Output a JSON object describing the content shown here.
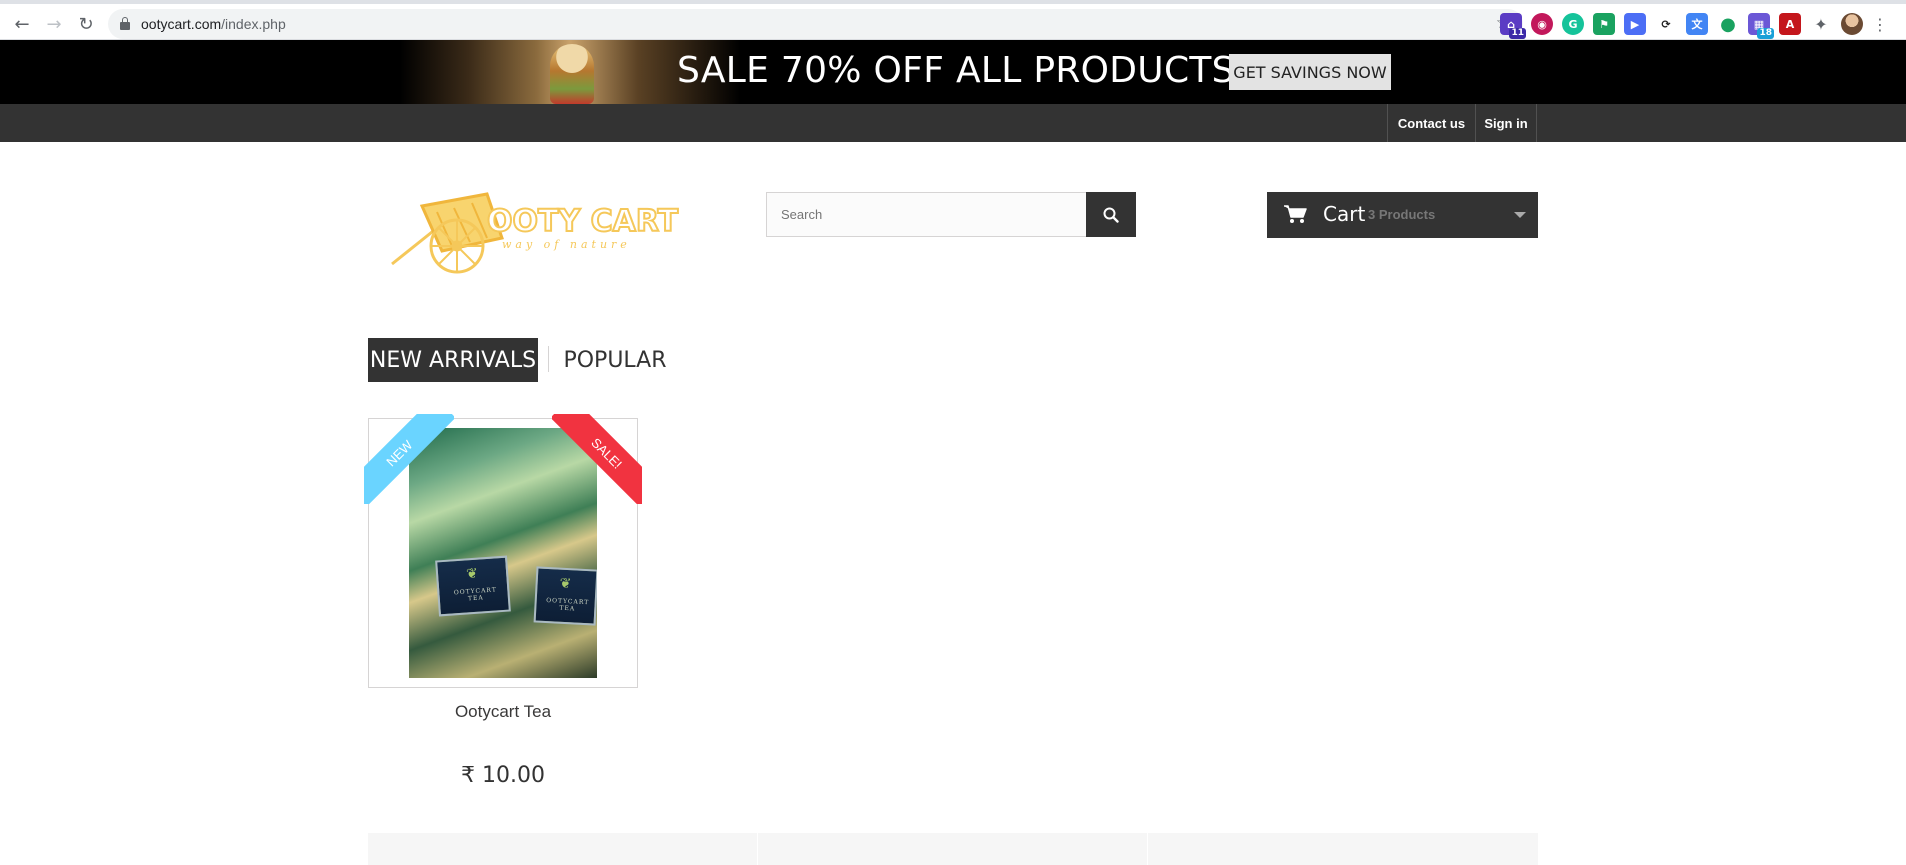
{
  "browser": {
    "url_host": "ootycart.com",
    "url_path": "/index.php",
    "extension_badges": [
      "11",
      "18"
    ]
  },
  "promo": {
    "headline": "SALE 70% OFF ALL PRODUCTS",
    "button_label": "GET SAVINGS NOW"
  },
  "topnav": {
    "contact_label": "Contact us",
    "signin_label": "Sign in"
  },
  "logo": {
    "title": "OOTY CART",
    "tagline": "way of nature",
    "color": "#f5c85a"
  },
  "search": {
    "placeholder": "Search"
  },
  "cart": {
    "label": "Cart",
    "count": "3 Products"
  },
  "tabs": [
    {
      "label": "NEW ARRIVALS",
      "active": true
    },
    {
      "label": "POPULAR",
      "active": false
    }
  ],
  "product": {
    "name": "Ootycart Tea",
    "price": "₹ 10.00",
    "badge_new": "NEW",
    "badge_sale": "SALE!",
    "pack_text": "OOTYCART TEA"
  },
  "colors": {
    "dark": "#333333",
    "new_badge": "#6ad4ff",
    "sale_badge": "#f13340"
  }
}
